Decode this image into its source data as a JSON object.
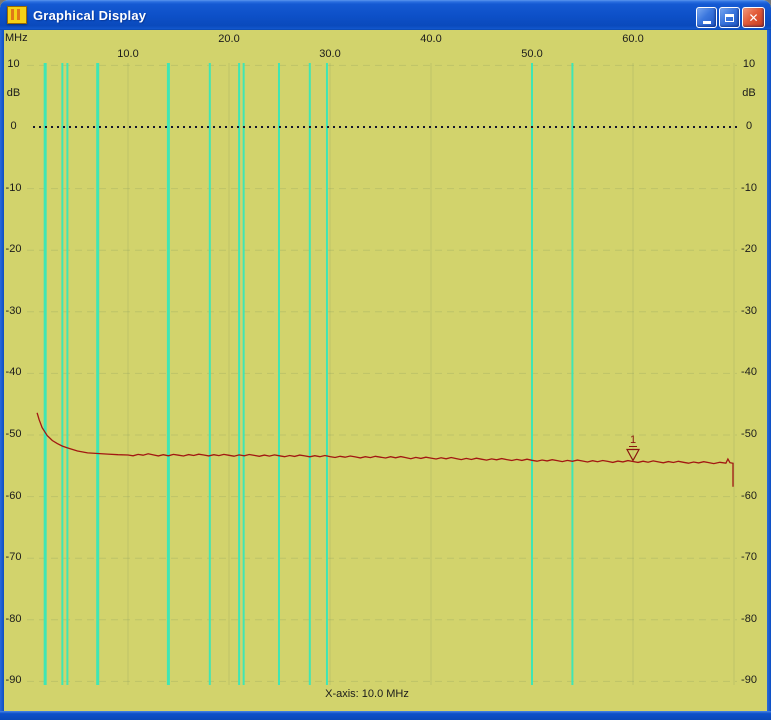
{
  "window": {
    "title": "Graphical Display",
    "controls": {
      "minimize": "minimize",
      "maximize": "maximize",
      "close": "close"
    }
  },
  "colors": {
    "background": "#d2d36c",
    "band_line": "#3fe6b4",
    "trace": "#a21712",
    "zero_line": "#16162c",
    "faint_grid": "#8fa060",
    "marker": "#8b1510",
    "text": "#1b1b1b",
    "titlebar_blue": "#0d50c8"
  },
  "x_axis": {
    "unit": "MHz",
    "ticks": [
      {
        "label": "10.0",
        "mhz": 10,
        "row": 2
      },
      {
        "label": "20.0",
        "mhz": 20,
        "row": 1
      },
      {
        "label": "30.0",
        "mhz": 30,
        "row": 2
      },
      {
        "label": "40.0",
        "mhz": 40,
        "row": 1
      },
      {
        "label": "50.0",
        "mhz": 50,
        "row": 2
      },
      {
        "label": "60.0",
        "mhz": 60,
        "row": 1
      }
    ]
  },
  "y_axis": {
    "unit": "dB",
    "ticks": [
      {
        "label": "10",
        "db": 10
      },
      {
        "label": "0",
        "db": 0
      },
      {
        "label": "-10",
        "db": -10
      },
      {
        "label": "-20",
        "db": -20
      },
      {
        "label": "-30",
        "db": -30
      },
      {
        "label": "-40",
        "db": -40
      },
      {
        "label": "-50",
        "db": -50
      },
      {
        "label": "-60",
        "db": -60
      },
      {
        "label": "-70",
        "db": -70
      },
      {
        "label": "-80",
        "db": -80
      },
      {
        "label": "-90",
        "db": -90
      }
    ]
  },
  "footer": {
    "x_axis_info": "X-axis: 10.0 MHz"
  },
  "chart_data": {
    "type": "line",
    "title": "",
    "xlabel": "MHz",
    "ylabel": "dB",
    "x_range": [
      0,
      70.5
    ],
    "y_range": [
      -90,
      10
    ],
    "grid": "faint grid every 10 MHz / 10 dB; dotted reference line at 0 dB",
    "band_marker_lines_mhz": [
      1.8,
      3.5,
      4.0,
      7.0,
      14.0,
      18.1,
      21.0,
      21.45,
      24.95,
      28.0,
      29.7,
      50.0,
      54.0
    ],
    "wide_band_lines_mhz": [
      1.8,
      7.0,
      14.0
    ],
    "series": [
      {
        "name": "trace",
        "color": "#a21712",
        "points": [
          [
            1.0,
            -46.4
          ],
          [
            1.2,
            -47.5
          ],
          [
            1.5,
            -48.8
          ],
          [
            2.0,
            -50.1
          ],
          [
            2.5,
            -50.9
          ],
          [
            3.0,
            -51.4
          ],
          [
            3.5,
            -51.8
          ],
          [
            4.0,
            -52.1
          ],
          [
            5.0,
            -52.6
          ],
          [
            6.0,
            -52.9
          ],
          [
            7.0,
            -53.0
          ],
          [
            8.0,
            -53.1
          ],
          [
            9.0,
            -53.2
          ],
          [
            10.0,
            -53.25
          ],
          [
            12.0,
            -53.2
          ],
          [
            14.0,
            -53.3
          ],
          [
            16.0,
            -53.25
          ],
          [
            18.0,
            -53.25
          ],
          [
            20.0,
            -53.3
          ],
          [
            22.0,
            -53.3
          ],
          [
            24.0,
            -53.35
          ],
          [
            26.0,
            -53.4
          ],
          [
            28.0,
            -53.4
          ],
          [
            30.0,
            -53.5
          ],
          [
            32.0,
            -53.55
          ],
          [
            34.0,
            -53.6
          ],
          [
            36.0,
            -53.6
          ],
          [
            38.0,
            -53.7
          ],
          [
            40.0,
            -53.75
          ],
          [
            42.0,
            -53.8
          ],
          [
            44.0,
            -53.9
          ],
          [
            46.0,
            -53.95
          ],
          [
            48.0,
            -54.0
          ],
          [
            50.0,
            -54.1
          ],
          [
            52.0,
            -54.15
          ],
          [
            54.0,
            -54.2
          ],
          [
            56.0,
            -54.25
          ],
          [
            58.0,
            -54.3
          ],
          [
            60.0,
            -54.3
          ],
          [
            62.0,
            -54.35
          ],
          [
            64.0,
            -54.4
          ],
          [
            66.0,
            -54.45
          ],
          [
            68.0,
            -54.5
          ],
          [
            69.2,
            -54.5
          ],
          [
            69.4,
            -53.9
          ],
          [
            69.6,
            -54.5
          ],
          [
            69.9,
            -54.6
          ],
          [
            69.9,
            -58.4
          ]
        ]
      }
    ],
    "marker": {
      "label": "1",
      "mhz": 60,
      "db": -54.3
    }
  }
}
